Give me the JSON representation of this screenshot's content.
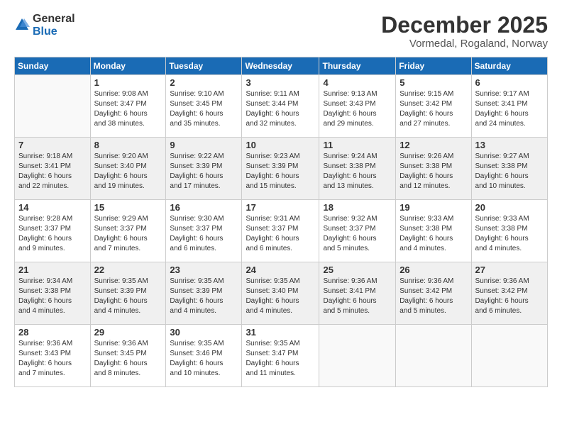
{
  "logo": {
    "general": "General",
    "blue": "Blue"
  },
  "title": "December 2025",
  "location": "Vormedal, Rogaland, Norway",
  "days_of_week": [
    "Sunday",
    "Monday",
    "Tuesday",
    "Wednesday",
    "Thursday",
    "Friday",
    "Saturday"
  ],
  "weeks": [
    [
      {
        "day": "",
        "detail": ""
      },
      {
        "day": "1",
        "detail": "Sunrise: 9:08 AM\nSunset: 3:47 PM\nDaylight: 6 hours\nand 38 minutes."
      },
      {
        "day": "2",
        "detail": "Sunrise: 9:10 AM\nSunset: 3:45 PM\nDaylight: 6 hours\nand 35 minutes."
      },
      {
        "day": "3",
        "detail": "Sunrise: 9:11 AM\nSunset: 3:44 PM\nDaylight: 6 hours\nand 32 minutes."
      },
      {
        "day": "4",
        "detail": "Sunrise: 9:13 AM\nSunset: 3:43 PM\nDaylight: 6 hours\nand 29 minutes."
      },
      {
        "day": "5",
        "detail": "Sunrise: 9:15 AM\nSunset: 3:42 PM\nDaylight: 6 hours\nand 27 minutes."
      },
      {
        "day": "6",
        "detail": "Sunrise: 9:17 AM\nSunset: 3:41 PM\nDaylight: 6 hours\nand 24 minutes."
      }
    ],
    [
      {
        "day": "7",
        "detail": "Sunrise: 9:18 AM\nSunset: 3:41 PM\nDaylight: 6 hours\nand 22 minutes."
      },
      {
        "day": "8",
        "detail": "Sunrise: 9:20 AM\nSunset: 3:40 PM\nDaylight: 6 hours\nand 19 minutes."
      },
      {
        "day": "9",
        "detail": "Sunrise: 9:22 AM\nSunset: 3:39 PM\nDaylight: 6 hours\nand 17 minutes."
      },
      {
        "day": "10",
        "detail": "Sunrise: 9:23 AM\nSunset: 3:39 PM\nDaylight: 6 hours\nand 15 minutes."
      },
      {
        "day": "11",
        "detail": "Sunrise: 9:24 AM\nSunset: 3:38 PM\nDaylight: 6 hours\nand 13 minutes."
      },
      {
        "day": "12",
        "detail": "Sunrise: 9:26 AM\nSunset: 3:38 PM\nDaylight: 6 hours\nand 12 minutes."
      },
      {
        "day": "13",
        "detail": "Sunrise: 9:27 AM\nSunset: 3:38 PM\nDaylight: 6 hours\nand 10 minutes."
      }
    ],
    [
      {
        "day": "14",
        "detail": "Sunrise: 9:28 AM\nSunset: 3:37 PM\nDaylight: 6 hours\nand 9 minutes."
      },
      {
        "day": "15",
        "detail": "Sunrise: 9:29 AM\nSunset: 3:37 PM\nDaylight: 6 hours\nand 7 minutes."
      },
      {
        "day": "16",
        "detail": "Sunrise: 9:30 AM\nSunset: 3:37 PM\nDaylight: 6 hours\nand 6 minutes."
      },
      {
        "day": "17",
        "detail": "Sunrise: 9:31 AM\nSunset: 3:37 PM\nDaylight: 6 hours\nand 6 minutes."
      },
      {
        "day": "18",
        "detail": "Sunrise: 9:32 AM\nSunset: 3:37 PM\nDaylight: 6 hours\nand 5 minutes."
      },
      {
        "day": "19",
        "detail": "Sunrise: 9:33 AM\nSunset: 3:38 PM\nDaylight: 6 hours\nand 4 minutes."
      },
      {
        "day": "20",
        "detail": "Sunrise: 9:33 AM\nSunset: 3:38 PM\nDaylight: 6 hours\nand 4 minutes."
      }
    ],
    [
      {
        "day": "21",
        "detail": "Sunrise: 9:34 AM\nSunset: 3:38 PM\nDaylight: 6 hours\nand 4 minutes."
      },
      {
        "day": "22",
        "detail": "Sunrise: 9:35 AM\nSunset: 3:39 PM\nDaylight: 6 hours\nand 4 minutes."
      },
      {
        "day": "23",
        "detail": "Sunrise: 9:35 AM\nSunset: 3:39 PM\nDaylight: 6 hours\nand 4 minutes."
      },
      {
        "day": "24",
        "detail": "Sunrise: 9:35 AM\nSunset: 3:40 PM\nDaylight: 6 hours\nand 4 minutes."
      },
      {
        "day": "25",
        "detail": "Sunrise: 9:36 AM\nSunset: 3:41 PM\nDaylight: 6 hours\nand 5 minutes."
      },
      {
        "day": "26",
        "detail": "Sunrise: 9:36 AM\nSunset: 3:42 PM\nDaylight: 6 hours\nand 5 minutes."
      },
      {
        "day": "27",
        "detail": "Sunrise: 9:36 AM\nSunset: 3:42 PM\nDaylight: 6 hours\nand 6 minutes."
      }
    ],
    [
      {
        "day": "28",
        "detail": "Sunrise: 9:36 AM\nSunset: 3:43 PM\nDaylight: 6 hours\nand 7 minutes."
      },
      {
        "day": "29",
        "detail": "Sunrise: 9:36 AM\nSunset: 3:45 PM\nDaylight: 6 hours\nand 8 minutes."
      },
      {
        "day": "30",
        "detail": "Sunrise: 9:35 AM\nSunset: 3:46 PM\nDaylight: 6 hours\nand 10 minutes."
      },
      {
        "day": "31",
        "detail": "Sunrise: 9:35 AM\nSunset: 3:47 PM\nDaylight: 6 hours\nand 11 minutes."
      },
      {
        "day": "",
        "detail": ""
      },
      {
        "day": "",
        "detail": ""
      },
      {
        "day": "",
        "detail": ""
      }
    ]
  ]
}
